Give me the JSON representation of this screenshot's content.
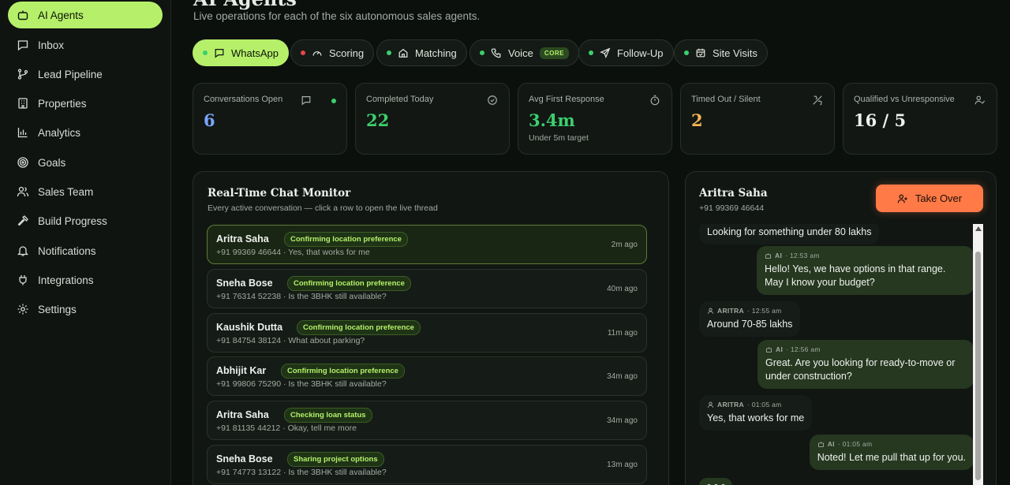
{
  "sidebar": {
    "items": [
      {
        "label": "AI Agents",
        "icon": "bot-icon"
      },
      {
        "label": "Inbox",
        "icon": "message-square-icon"
      },
      {
        "label": "Lead Pipeline",
        "icon": "git-branch-icon"
      },
      {
        "label": "Properties",
        "icon": "building-icon"
      },
      {
        "label": "Analytics",
        "icon": "bar-chart-icon"
      },
      {
        "label": "Goals",
        "icon": "target-icon"
      },
      {
        "label": "Sales Team",
        "icon": "users-icon"
      },
      {
        "label": "Build Progress",
        "icon": "hammer-icon"
      },
      {
        "label": "Notifications",
        "icon": "bell-icon"
      },
      {
        "label": "Integrations",
        "icon": "plug-icon"
      },
      {
        "label": "Settings",
        "icon": "gear-icon"
      }
    ]
  },
  "header": {
    "title": "AI Agents",
    "subtitle": "Live operations for each of the six autonomous sales agents."
  },
  "tabs": [
    {
      "label": "WhatsApp",
      "status_color": "#3ccf6e"
    },
    {
      "label": "Scoring",
      "status_color": "#e5484d"
    },
    {
      "label": "Matching",
      "status_color": "#3ccf6e"
    },
    {
      "label": "Voice",
      "status_color": "#3ccf6e",
      "badge": "CORE"
    },
    {
      "label": "Follow-Up",
      "status_color": "#3ccf6e"
    },
    {
      "label": "Site Visits",
      "status_color": "#3ccf6e"
    }
  ],
  "stats": [
    {
      "label": "Conversations Open",
      "value": "6",
      "color": "#7aa6ff"
    },
    {
      "label": "Completed Today",
      "value": "22",
      "color": "#3ccf6e"
    },
    {
      "label": "Avg First Response",
      "value": "3.4m",
      "sub": "Under 5m target",
      "color": "#3ccf6e"
    },
    {
      "label": "Timed Out / Silent",
      "value": "2",
      "color": "#f5b453"
    },
    {
      "label": "Qualified vs Unresponsive",
      "value": "16 / 5",
      "color": "#eef2ee"
    }
  ],
  "monitor": {
    "title": "Real-Time Chat Monitor",
    "subtitle": "Every active conversation — click a row to open the live thread",
    "rows": [
      {
        "name": "Aritra Saha",
        "status": "Confirming location preference",
        "meta": "+91 99369 46644 · Yes, that works for me",
        "time": "2m ago"
      },
      {
        "name": "Sneha Bose",
        "status": "Confirming location preference",
        "meta": "+91 76314 52238 · Is the 3BHK still available?",
        "time": "40m ago"
      },
      {
        "name": "Kaushik Dutta",
        "status": "Confirming location preference",
        "meta": "+91 84754 38124 · What about parking?",
        "time": "11m ago"
      },
      {
        "name": "Abhijit Kar",
        "status": "Confirming location preference",
        "meta": "+91 99806 75290 · Is the 3BHK still available?",
        "time": "34m ago"
      },
      {
        "name": "Aritra Saha",
        "status": "Checking loan status",
        "meta": "+91 81135 44212 · Okay, tell me more",
        "time": "34m ago"
      },
      {
        "name": "Sneha Bose",
        "status": "Sharing project options",
        "meta": "+91 74773 13122 · Is the 3BHK still available?",
        "time": "13m ago"
      }
    ]
  },
  "chat": {
    "name": "Aritra Saha",
    "phone": "+91 99369 46644",
    "takeover_label": "Take Over",
    "messages": [
      {
        "sender": "",
        "time": "",
        "text": "Looking for something under 80 lakhs"
      },
      {
        "sender": "AI",
        "time": "· 12:53 am",
        "text": "Hello! Yes, we have options in that range. May I know your budget?"
      },
      {
        "sender": "ARITRA",
        "time": "· 12:55 am",
        "text": "Around 70-85 lakhs"
      },
      {
        "sender": "AI",
        "time": "· 12:56 am",
        "text": "Great. Are you looking for ready-to-move or under construction?"
      },
      {
        "sender": "ARITRA",
        "time": "· 01:05 am",
        "text": "Yes, that works for me"
      },
      {
        "sender": "AI",
        "time": "· 01:05 am",
        "text": "Noted! Let me pull that up for you."
      }
    ]
  }
}
